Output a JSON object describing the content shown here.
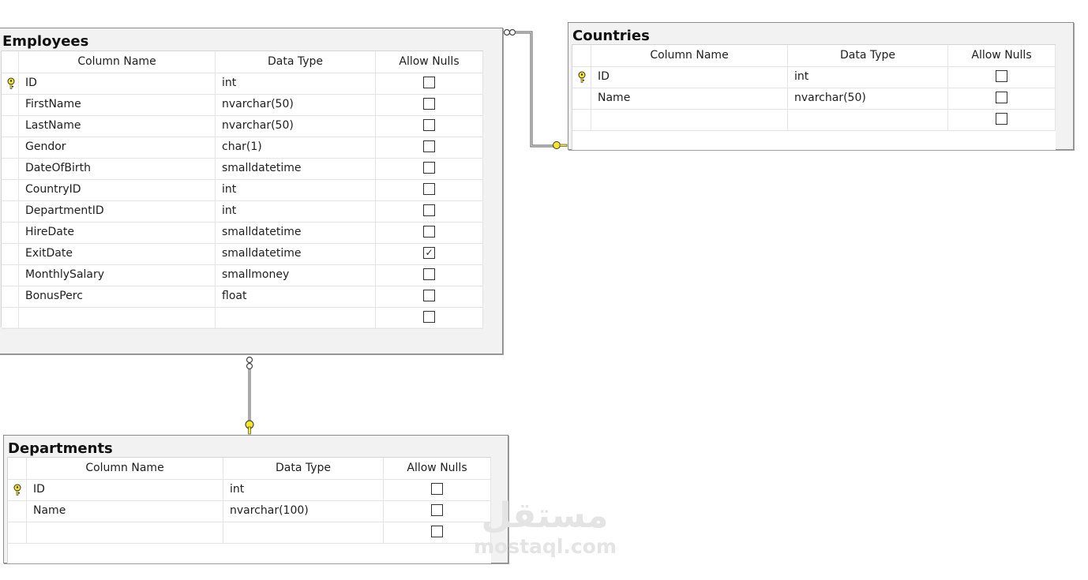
{
  "employees": {
    "title": "Employees",
    "headers": [
      "Column Name",
      "Data Type",
      "Allow Nulls"
    ],
    "rows": [
      {
        "name": "ID",
        "type": "int",
        "nulls": false,
        "pk": true
      },
      {
        "name": "FirstName",
        "type": "nvarchar(50)",
        "nulls": false,
        "pk": false
      },
      {
        "name": "LastName",
        "type": "nvarchar(50)",
        "nulls": false,
        "pk": false
      },
      {
        "name": "Gendor",
        "type": "char(1)",
        "nulls": false,
        "pk": false
      },
      {
        "name": "DateOfBirth",
        "type": "smalldatetime",
        "nulls": false,
        "pk": false
      },
      {
        "name": "CountryID",
        "type": "int",
        "nulls": false,
        "pk": false
      },
      {
        "name": "DepartmentID",
        "type": "int",
        "nulls": false,
        "pk": false
      },
      {
        "name": "HireDate",
        "type": "smalldatetime",
        "nulls": false,
        "pk": false
      },
      {
        "name": "ExitDate",
        "type": "smalldatetime",
        "nulls": true,
        "pk": false
      },
      {
        "name": "MonthlySalary",
        "type": "smallmoney",
        "nulls": false,
        "pk": false
      },
      {
        "name": "BonusPerc",
        "type": "float",
        "nulls": false,
        "pk": false
      },
      {
        "name": "",
        "type": "",
        "nulls": false,
        "pk": false
      }
    ]
  },
  "countries": {
    "title": "Countries",
    "headers": [
      "Column Name",
      "Data Type",
      "Allow Nulls"
    ],
    "rows": [
      {
        "name": "ID",
        "type": "int",
        "nulls": false,
        "pk": true
      },
      {
        "name": "Name",
        "type": "nvarchar(50)",
        "nulls": false,
        "pk": false
      },
      {
        "name": "",
        "type": "",
        "nulls": false,
        "pk": false
      }
    ]
  },
  "departments": {
    "title": "Departments",
    "headers": [
      "Column Name",
      "Data Type",
      "Allow Nulls"
    ],
    "rows": [
      {
        "name": "ID",
        "type": "int",
        "nulls": false,
        "pk": true
      },
      {
        "name": "Name",
        "type": "nvarchar(100)",
        "nulls": false,
        "pk": false
      },
      {
        "name": "",
        "type": "",
        "nulls": false,
        "pk": false
      }
    ]
  },
  "watermark": {
    "arabic": "مستقل",
    "latin": "mostaql.com"
  },
  "colors": {
    "key": "#f5e52a",
    "relation_line": "#555555",
    "border": "#8c8c8c"
  },
  "icons": {
    "primary_key": "key-icon",
    "checkbox_checked": "✓"
  }
}
